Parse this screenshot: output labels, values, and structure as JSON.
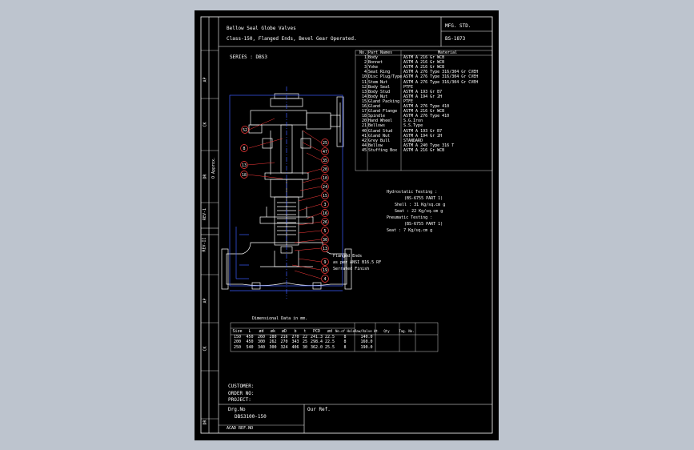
{
  "title_block": {
    "title_line1": "Bellow Seal Globe Valves",
    "title_line2": "Class-150, Flanged Ends, Bevel Gear Operated.",
    "std_label": "MFG. STD.",
    "std_value": "BS-1873"
  },
  "series_label": "SERIES : DBS3",
  "left_strip": [
    "AP",
    "CK",
    "DR",
    "REV-1",
    "REV-II",
    "AP",
    "CK",
    "DR"
  ],
  "vertical_dim": "O Approx.",
  "parts_table": {
    "headers": [
      "No.",
      "Part Names",
      "Material"
    ],
    "rows": [
      [
        "1",
        "Body",
        "ASTM A 216 Gr WCB"
      ],
      [
        "2",
        "Bonnet",
        "ASTM A 216 Gr WCB"
      ],
      [
        "3",
        "Yoke",
        "ASTM A 216 Gr WCB"
      ],
      [
        "4",
        "Seat Ring",
        "ASTM A 276 Type 316/304 Gr CVEH"
      ],
      [
        "10",
        "Disc Plug/Type",
        "ASTM A 276 Type 316/304 Gr CVEH"
      ],
      [
        "11",
        "Stem Nut",
        "ASTM A 276 Type 316/304 Gr CVEH"
      ],
      [
        "12",
        "Body Seal",
        "PTFE"
      ],
      [
        "13",
        "Body Stud",
        "ASTM A 193 Gr B7"
      ],
      [
        "14",
        "Body Nut",
        "ASTM A 194 Gr 2H"
      ],
      [
        "15",
        "Gland Packing",
        "PTFE"
      ],
      [
        "16",
        "Gland",
        "ASTM A 276 Type 410"
      ],
      [
        "17",
        "Gland Flange",
        "ASTM A 216 Gr WCB"
      ],
      [
        "18",
        "Spindle",
        "ASTM A 276 Type 410"
      ],
      [
        "20",
        "Hand Wheel",
        "S.G.Iron"
      ],
      [
        "21",
        "Bellows",
        "S.S.Type"
      ],
      [
        "40",
        "Gland Stud",
        "ASTM A 193 Gr B7"
      ],
      [
        "41",
        "Gland Nut",
        "ASTM A 194 Gr 2H"
      ],
      [
        "42",
        "Grey Bull",
        "STANDARD"
      ],
      [
        "44",
        "Bellow",
        "ASTM A 240 Type 316 T"
      ],
      [
        "45",
        "Stuffing Box",
        "ASTM A 216 Gr WCB"
      ]
    ]
  },
  "testing": {
    "hydro_title": "Hydrostatic Testing :",
    "hydro_ref": "(BS-6755 PART 1)",
    "shell": "Shell : 31 Kg/sq.cm g",
    "seat": "Seat : 22 Kg/sq.cm g",
    "pneu_title": "Pneumatic Testing :",
    "pneu_ref": "(BS-6755 PART 1)",
    "pneu_seat": "Seat : 7 Kg/sq.cm g"
  },
  "callouts": {
    "left": [
      "52",
      "8",
      "13",
      "18"
    ],
    "right": [
      "25",
      "47",
      "35",
      "20",
      "10",
      "24",
      "15",
      "3",
      "16",
      "26",
      "5",
      "30",
      "13",
      "9",
      "19",
      "4"
    ]
  },
  "notes": {
    "flanged_ends": "Flanged Ends",
    "flanged_line2": "as per ANSI B16.5 RF",
    "flanged_line3": "Serrated Finish"
  },
  "dims_table": {
    "caption": "Dimensional Data in mm.",
    "headers": [
      "Size",
      "L",
      "ød",
      "øk",
      "øD",
      "b",
      "t",
      "PCD",
      "ød",
      "No.of Holes",
      "Raw/Valve Wt. Kgs",
      "Qty",
      "Tag. No."
    ],
    "rows": [
      [
        "150",
        "450",
        "260",
        "280",
        "216",
        "270",
        "22",
        "241.3",
        "22.5",
        "8",
        "140.0",
        "",
        ""
      ],
      [
        "200",
        "450",
        "300",
        "262",
        "270",
        "343",
        "25",
        "298.4",
        "22.5",
        "8",
        "160.0",
        "",
        ""
      ],
      [
        "250",
        "540",
        "340",
        "300",
        "324",
        "406",
        "30",
        "362.0",
        "25.5",
        "8",
        "190.0",
        "",
        ""
      ]
    ]
  },
  "footer": {
    "customer": "CUSTOMER:",
    "order_no": "ORDER NO:",
    "project": "PROJECT:",
    "drg_label": "Drg.No",
    "drg_value": "DBS3100-150",
    "our_ref": "Our Ref.",
    "sheet_note": "ACAD REF.NO"
  },
  "colors": {
    "background": "#bdc4ce",
    "sheet": "#000000",
    "lines": "#ffffff",
    "valve": "#ffffff",
    "callout_red": "#ff3b3b",
    "dimension_blue": "#3c5bff"
  }
}
